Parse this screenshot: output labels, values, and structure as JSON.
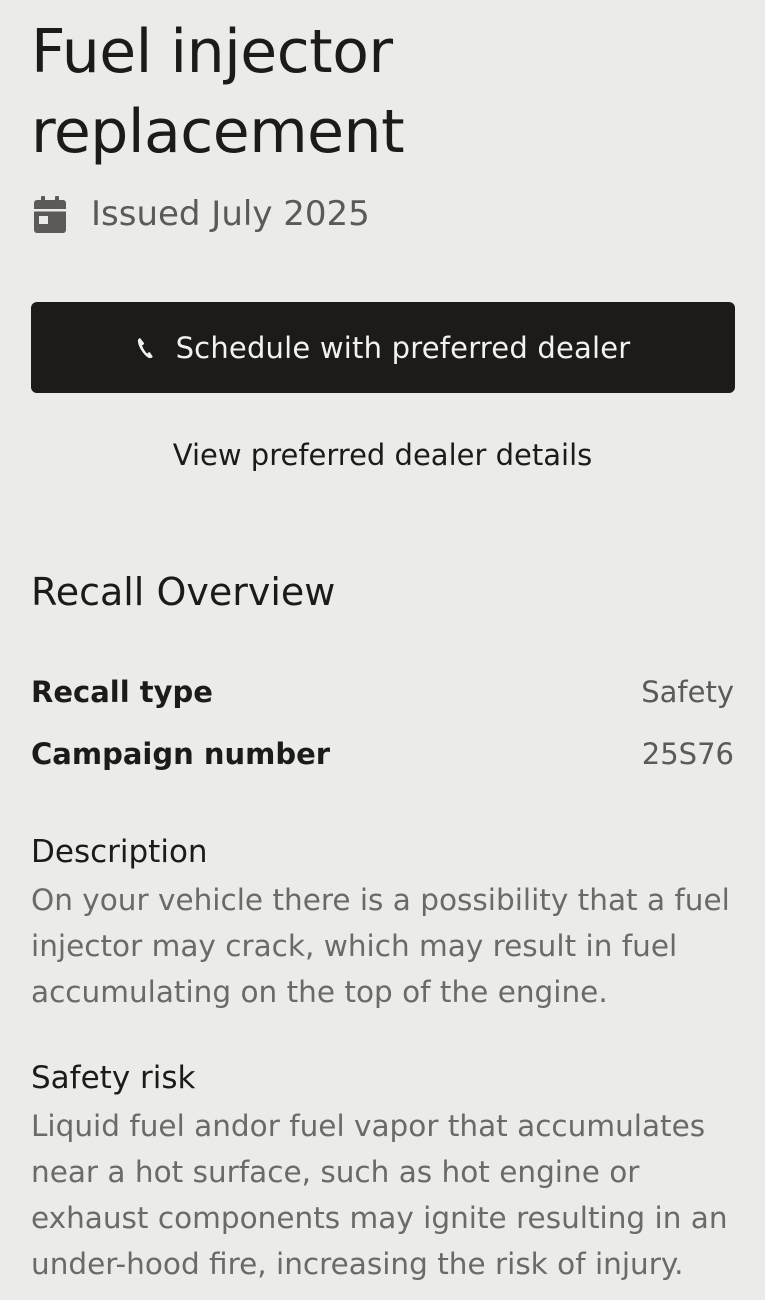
{
  "recall": {
    "title": "Fuel injector replacement",
    "issued": "Issued July 2025",
    "calendar_icon": "calendar-icon"
  },
  "actions": {
    "schedule_label": "Schedule with preferred dealer",
    "schedule_icon": "phone-icon",
    "view_dealer_label": "View preferred dealer details"
  },
  "overview": {
    "section_title": "Recall Overview",
    "rows": [
      {
        "label": "Recall type",
        "value": "Safety"
      },
      {
        "label": "Campaign number",
        "value": "25S76"
      }
    ],
    "description": {
      "title": "Description",
      "body": "On your vehicle there is a possibility that a fuel injector may crack, which may result in fuel accumulating on the top of the engine."
    },
    "safety_risk": {
      "title": "Safety risk",
      "body": "Liquid fuel andor fuel vapor that accumulates near a hot surface, such as hot engine or exhaust components may ignite resulting in an under-hood fire, increasing the risk of injury."
    }
  },
  "colors": {
    "background": "#ebebea",
    "primary_button": "#1c1b1a",
    "secondary_text": "#5b5a58"
  }
}
